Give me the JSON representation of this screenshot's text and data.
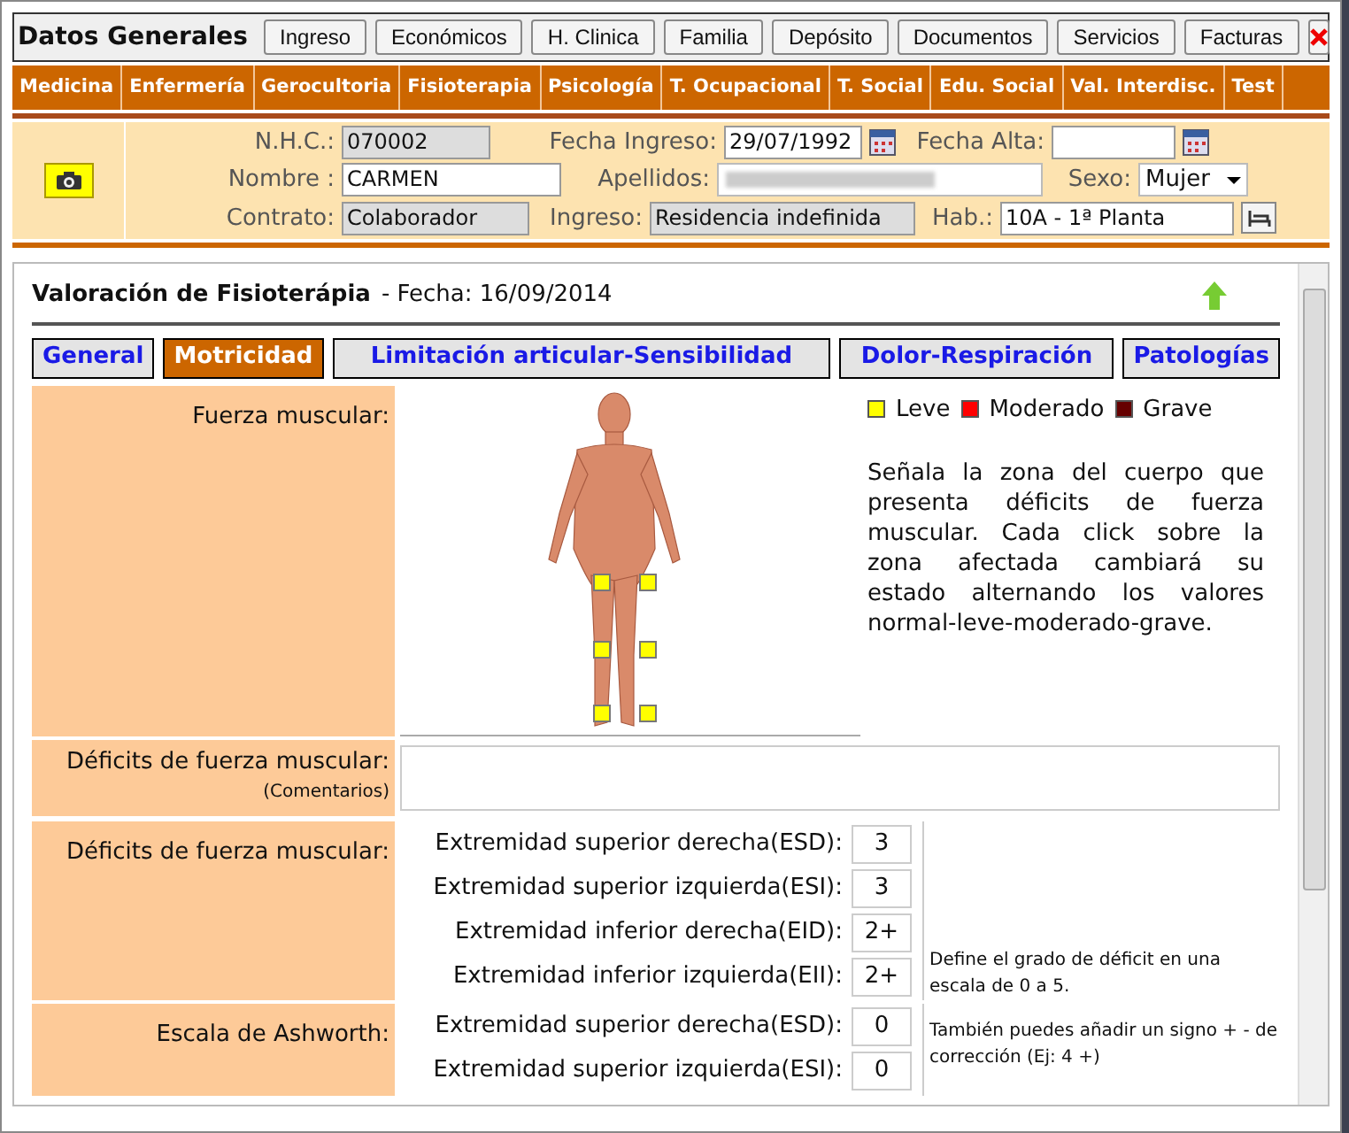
{
  "header": {
    "title": "Datos Generales",
    "buttons": [
      "Ingreso",
      "Económicos",
      "H. Clinica",
      "Familia",
      "Depósito",
      "Documentos",
      "Servicios",
      "Facturas"
    ]
  },
  "departments": [
    "Medicina",
    "Enfermería",
    "Gerocultoria",
    "Fisioterapia",
    "Psicología",
    "T. Ocupacional",
    "T. Social",
    "Edu. Social",
    "Val. Interdisc.",
    "Test"
  ],
  "patient": {
    "nhc_label": "N.H.C.:",
    "nhc": "070002",
    "ingreso_label": "Fecha Ingreso:",
    "fecha_ingreso": "29/07/1992",
    "alta_label": "Fecha Alta:",
    "nombre_label": "Nombre :",
    "nombre": "CARMEN",
    "apellidos_label": "Apellidos:",
    "sexo_label": "Sexo:",
    "sexo": "Mujer",
    "contrato_label": "Contrato:",
    "contrato": "Colaborador",
    "tipo_label": "Ingreso:",
    "tipo": "Residencia indefinida",
    "hab_label": "Hab.:",
    "hab": "10A - 1ª Planta"
  },
  "assessment": {
    "title": "Valoración de Fisioterápia",
    "date": "- Fecha: 16/09/2014",
    "tabs": [
      {
        "label": "General",
        "selected": false
      },
      {
        "label": "Motricidad",
        "selected": true
      },
      {
        "label": "Limitación articular-Sensibilidad",
        "selected": false
      },
      {
        "label": "Dolor-Respiración",
        "selected": false
      },
      {
        "label": "Patologías",
        "selected": false
      }
    ],
    "strength_label": "Fuerza muscular:",
    "legend": [
      {
        "label": "Leve",
        "color": "#ffff00"
      },
      {
        "label": "Moderado",
        "color": "#ff0000"
      },
      {
        "label": "Grave",
        "color": "#660000"
      }
    ],
    "markers": [
      {
        "color": "#ffff00"
      },
      {
        "color": "#ffff00"
      },
      {
        "color": "#ffff00"
      },
      {
        "color": "#ffff00"
      },
      {
        "color": "#ffff00"
      },
      {
        "color": "#ffff00"
      }
    ],
    "instructions": "Señala la zona del cuerpo que presenta déficits de fuerza muscular. Cada click sobre la zona afectada cambiará su estado alternando los valores normal-leve-moderado-grave.",
    "comments_label": "Déficits de fuerza muscular:",
    "comments_sublabel": "(Comentarios)",
    "deficits_label": "Déficits de fuerza muscular:",
    "deficits": [
      {
        "label": "Extremidad superior derecha(ESD):",
        "value": "3"
      },
      {
        "label": "Extremidad superior izquierda(ESI):",
        "value": "3"
      },
      {
        "label": "Extremidad inferior derecha(EID):",
        "value": "2+"
      },
      {
        "label": "Extremidad inferior izquierda(EII):",
        "value": "2+"
      }
    ],
    "ashworth_label": "Escala de Ashworth:",
    "ashworth": [
      {
        "label": "Extremidad superior derecha(ESD):",
        "value": "0"
      },
      {
        "label": "Extremidad superior izquierda(ESI):",
        "value": "0"
      }
    ],
    "note_1": "Define el grado de déficit en una escala de 0 a 5.",
    "note_2": "También puedes añadir un signo + - de corrección (Ej: 4 +)"
  }
}
